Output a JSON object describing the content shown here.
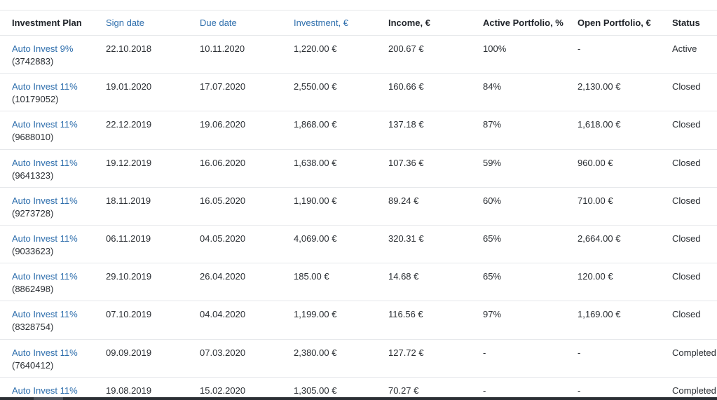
{
  "columns": [
    {
      "label": "Investment Plan",
      "sortable": false
    },
    {
      "label": "Sign date",
      "sortable": true
    },
    {
      "label": "Due date",
      "sortable": true
    },
    {
      "label": "Investment, €",
      "sortable": true
    },
    {
      "label": "Income, €",
      "sortable": false
    },
    {
      "label": "Active Portfolio, %",
      "sortable": false
    },
    {
      "label": "Open Portfolio, €",
      "sortable": false
    },
    {
      "label": "Status",
      "sortable": false
    }
  ],
  "rows": [
    {
      "plan": "Auto Invest 9%",
      "plan_id": "(3742883)",
      "sign": "22.10.2018",
      "due": "10.11.2020",
      "investment": "1,220.00 €",
      "income": "200.67 €",
      "active": "100%",
      "open": "-",
      "status": "Active"
    },
    {
      "plan": "Auto Invest 11%",
      "plan_id": "(10179052)",
      "sign": "19.01.2020",
      "due": "17.07.2020",
      "investment": "2,550.00 €",
      "income": "160.66 €",
      "active": "84%",
      "open": "2,130.00 €",
      "status": "Closed"
    },
    {
      "plan": "Auto Invest 11%",
      "plan_id": "(9688010)",
      "sign": "22.12.2019",
      "due": "19.06.2020",
      "investment": "1,868.00 €",
      "income": "137.18 €",
      "active": "87%",
      "open": "1,618.00 €",
      "status": "Closed"
    },
    {
      "plan": "Auto Invest 11%",
      "plan_id": "(9641323)",
      "sign": "19.12.2019",
      "due": "16.06.2020",
      "investment": "1,638.00 €",
      "income": "107.36 €",
      "active": "59%",
      "open": "960.00 €",
      "status": "Closed"
    },
    {
      "plan": "Auto Invest 11%",
      "plan_id": "(9273728)",
      "sign": "18.11.2019",
      "due": "16.05.2020",
      "investment": "1,190.00 €",
      "income": "89.24 €",
      "active": "60%",
      "open": "710.00 €",
      "status": "Closed"
    },
    {
      "plan": "Auto Invest 11%",
      "plan_id": "(9033623)",
      "sign": "06.11.2019",
      "due": "04.05.2020",
      "investment": "4,069.00 €",
      "income": "320.31 €",
      "active": "65%",
      "open": "2,664.00 €",
      "status": "Closed"
    },
    {
      "plan": "Auto Invest 11%",
      "plan_id": "(8862498)",
      "sign": "29.10.2019",
      "due": "26.04.2020",
      "investment": "185.00 €",
      "income": "14.68 €",
      "active": "65%",
      "open": "120.00 €",
      "status": "Closed"
    },
    {
      "plan": "Auto Invest 11%",
      "plan_id": "(8328754)",
      "sign": "07.10.2019",
      "due": "04.04.2020",
      "investment": "1,199.00 €",
      "income": "116.56 €",
      "active": "97%",
      "open": "1,169.00 €",
      "status": "Closed"
    },
    {
      "plan": "Auto Invest 11%",
      "plan_id": "(7640412)",
      "sign": "09.09.2019",
      "due": "07.03.2020",
      "investment": "2,380.00 €",
      "income": "127.72 €",
      "active": "-",
      "open": "-",
      "status": "Completed"
    },
    {
      "plan": "Auto Invest 11%",
      "plan_id": "",
      "sign": "19.08.2019",
      "due": "15.02.2020",
      "investment": "1,305.00 €",
      "income": "70.27 €",
      "active": "-",
      "open": "-",
      "status": "Completed"
    }
  ],
  "colors": {
    "link": "#2f6fad",
    "text": "#2a2e33",
    "border": "#e6e8eb"
  }
}
